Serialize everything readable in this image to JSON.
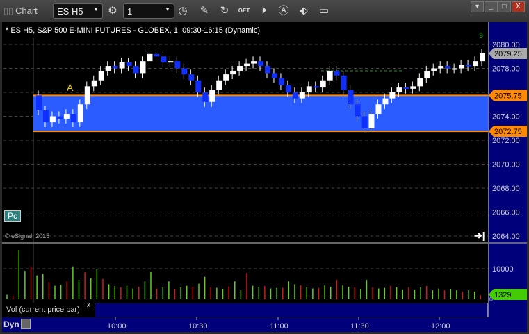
{
  "window": {
    "title": "Chart",
    "symbol": "ES H5",
    "interval": "1"
  },
  "header": "* ES H5, S&P 500 E-MINI FUTURES - GLOBEX, 1, 09:30-16:15 (Dynamic)",
  "copyright": "© eSignal, 2015",
  "price_axis": {
    "ticks": [
      "2080.00",
      "2078.00",
      "2076.00",
      "2074.00",
      "2072.00",
      "2070.00",
      "2068.00",
      "2066.00",
      "2064.00"
    ],
    "last": "2079.25",
    "upper_level": "2075.75",
    "lower_level": "2072.75"
  },
  "volume": {
    "label": "Vol (current price bar)",
    "close": "x",
    "tick": "10000",
    "zero": "0",
    "last": "1329"
  },
  "time_axis": {
    "mode": "Dyn",
    "ticks": [
      "10:00",
      "10:30",
      "11:00",
      "11:30",
      "12:00"
    ]
  },
  "annotations": {
    "marker_a": "A",
    "pc": "Pc",
    "seq_top": "9"
  },
  "colors": {
    "zone": "#2a5cff",
    "zone_edge": "#ff8a00",
    "up_vol": "#5fd01c",
    "down_vol": "#d01a1a",
    "axis_bg": "#00007a"
  },
  "chart_data": {
    "type": "candlestick",
    "closes": [
      2074.5,
      2073.5,
      2074,
      2073.8,
      2074.2,
      2073.5,
      2075,
      2076.5,
      2077,
      2077.8,
      2078.2,
      2078,
      2078.5,
      2078.2,
      2077.6,
      2078.6,
      2079.2,
      2079,
      2078.5,
      2078.6,
      2078,
      2077.5,
      2077,
      2076,
      2075.2,
      2076.2,
      2077,
      2077.5,
      2077.8,
      2078.2,
      2078.4,
      2078.6,
      2078.2,
      2077.6,
      2077.2,
      2076.6,
      2076,
      2075.5,
      2076,
      2076.5,
      2076.4,
      2077,
      2077.8,
      2077.4,
      2076.2,
      2075,
      2074,
      2073,
      2074.2,
      2075,
      2075.5,
      2076,
      2076.4,
      2076.3,
      2076.5,
      2077.2,
      2077.8,
      2078,
      2078.2,
      2078,
      2078,
      2078.3,
      2078.2,
      2078.6,
      2079.25
    ],
    "volumes": [
      1500,
      1200,
      16500,
      9500,
      11000,
      8000,
      8500,
      5800,
      4500,
      4800,
      6000,
      11000,
      6500,
      9000,
      7000,
      10000,
      6800,
      5000,
      4400,
      4000,
      4500,
      3600,
      4200,
      6000,
      9200,
      3600,
      4000,
      6000,
      3500,
      4000,
      4500,
      4200,
      5200,
      7500,
      4000,
      3800,
      3500,
      4300,
      6000,
      3000,
      8800,
      4500,
      4100,
      4400,
      3600,
      3800,
      3800,
      6000,
      5000,
      4600,
      4000,
      3600,
      3800,
      4600,
      4200,
      6500,
      4600,
      4200,
      4000,
      3500,
      6500,
      4000,
      3600,
      3800,
      4500,
      4000,
      3300,
      4000,
      3200,
      4000,
      4400,
      3000,
      3600,
      3000,
      3500,
      3000,
      2500,
      3000,
      2600,
      1329
    ],
    "ylim": [
      2063.5,
      2081
    ],
    "levels": [
      2075.75,
      2072.75
    ]
  }
}
